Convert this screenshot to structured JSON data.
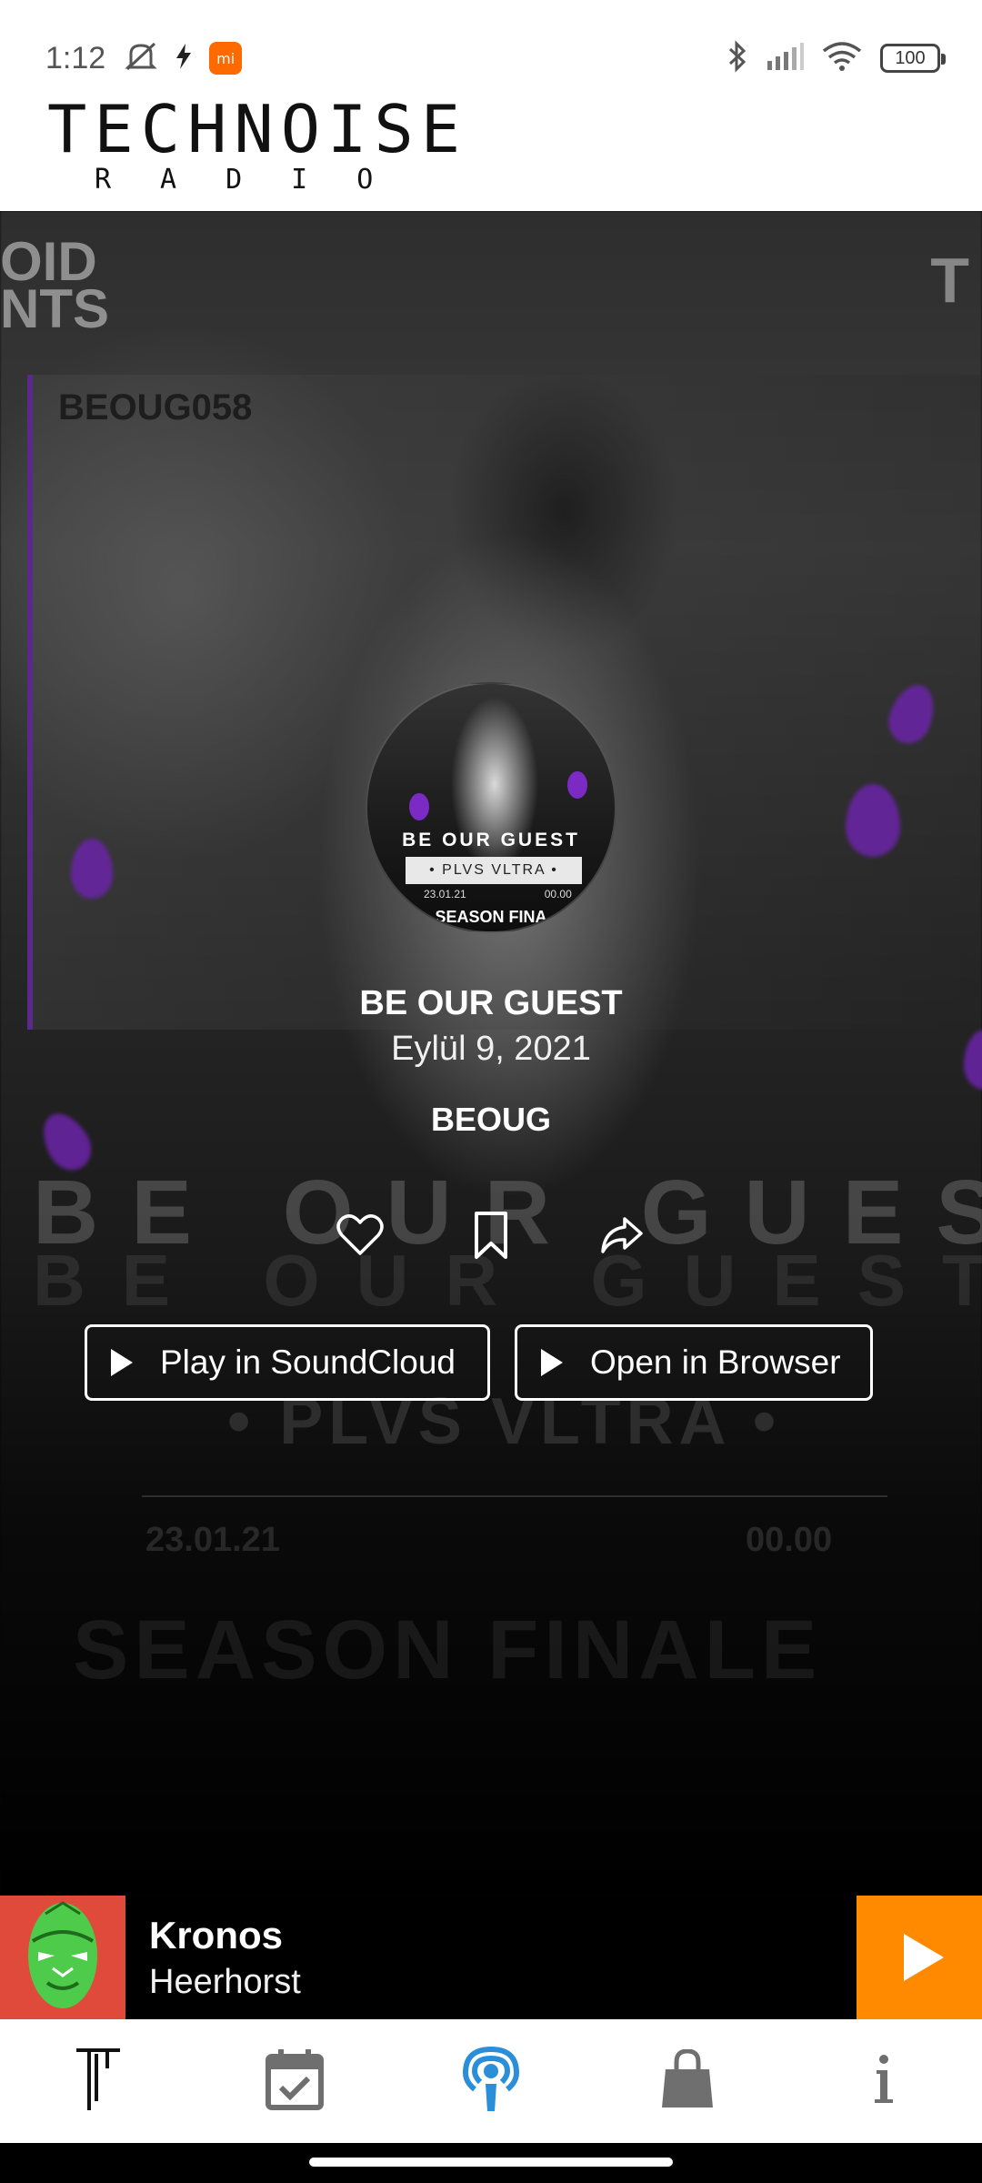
{
  "status_bar": {
    "time": "1:12",
    "battery": "100",
    "icons": [
      "mute-icon",
      "flash-icon",
      "mi-app-icon",
      "bluetooth-icon",
      "signal-icon",
      "wifi-icon",
      "battery-icon"
    ]
  },
  "header": {
    "logo_word": "TECHNOISE",
    "logo_sub": "RADIO"
  },
  "background": {
    "oid_text": "OID\nNTS",
    "catalog": "BEOUG058",
    "corner": "T",
    "big_title": "BE OUR GUEST",
    "edition": "• PLVS VLTRA •",
    "date": "23.01.21",
    "time": "00.00",
    "season": "SEASON FINALE"
  },
  "cover": {
    "title": "BE OUR GUEST",
    "edition": "• PLVS VLTRA •",
    "date": "23.01.21",
    "time": "00.00",
    "season": "SEASON FINA"
  },
  "episode": {
    "title": "BE OUR GUEST",
    "date": "Eylül 9, 2021",
    "show": "BEOUG"
  },
  "actions": {
    "icons": [
      "heart-icon",
      "bookmark-icon",
      "share-icon"
    ]
  },
  "buttons": {
    "soundcloud": "Play in SoundCloud",
    "browser": "Open in Browser"
  },
  "now_playing": {
    "track": "Kronos",
    "artist": "Heerhorst"
  },
  "nav": {
    "items": [
      "technoise-logo-icon",
      "calendar-check-icon",
      "podcast-icon",
      "shopping-bag-icon",
      "info-icon"
    ],
    "active": "podcast-icon",
    "active_color": "#2a8fd8",
    "inactive_color": "#6f6f6f"
  },
  "colors": {
    "accent": "#ff8a00",
    "art_bg": "#e04a3b",
    "purple": "#6b24a8"
  }
}
